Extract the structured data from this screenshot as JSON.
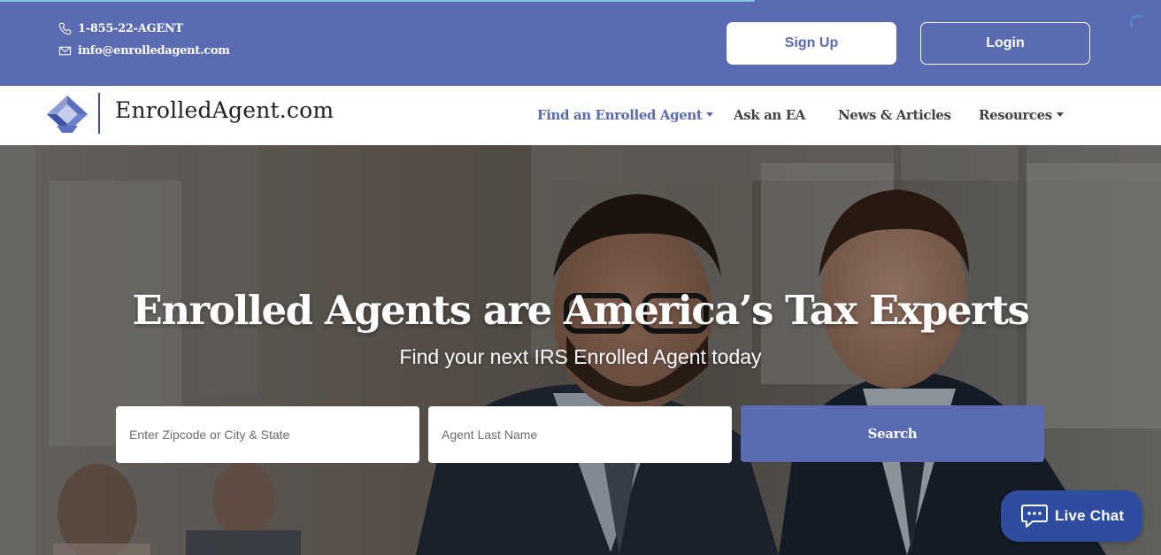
{
  "topbar": {
    "phone": "1-855-22-AGENT",
    "email": "info@enrolledagent.com",
    "signup_label": "Sign Up",
    "login_label": "Login",
    "accent_color": "#5a6bb4"
  },
  "logo": {
    "text": "EnrolledAgent.com"
  },
  "nav": {
    "items": [
      {
        "label": "Find an Enrolled Agent",
        "dropdown": true,
        "active": true
      },
      {
        "label": "Ask an EA",
        "dropdown": false,
        "active": false
      },
      {
        "label": "News & Articles",
        "dropdown": false,
        "active": false
      },
      {
        "label": "Resources",
        "dropdown": true,
        "active": false
      }
    ]
  },
  "hero": {
    "title": "Enrolled Agents are America’s Tax Experts",
    "subtitle": "Find your next IRS Enrolled Agent today",
    "location_placeholder": "Enter Zipcode or City & State",
    "lastname_placeholder": "Agent Last Name",
    "search_label": "Search"
  },
  "livechat": {
    "label": "Live Chat",
    "color": "#2e4da0"
  },
  "icons": [
    "phone-icon",
    "envelope-icon",
    "loading-spinner-icon",
    "logo-mark-icon",
    "chat-bubble-icon"
  ]
}
